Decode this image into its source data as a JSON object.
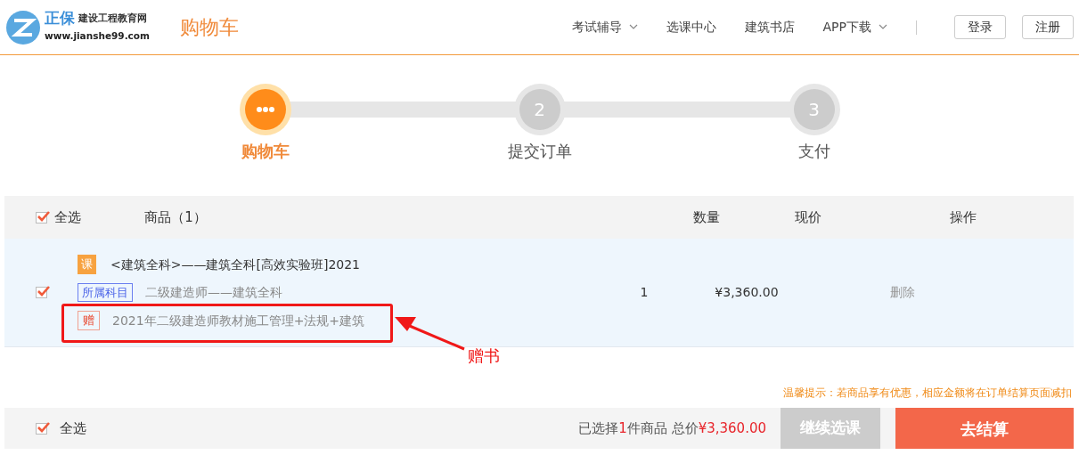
{
  "header": {
    "logo": {
      "brand": "正保",
      "tagline": "建设工程教育网",
      "url": "www.jianshe99.com"
    },
    "page_title": "购物车",
    "nav": [
      {
        "label": "考试辅导",
        "dropdown": true
      },
      {
        "label": "选课中心",
        "dropdown": false
      },
      {
        "label": "建筑书店",
        "dropdown": false
      },
      {
        "label": "APP下载",
        "dropdown": true
      }
    ],
    "buttons": [
      "登录",
      "注册"
    ]
  },
  "steps": [
    {
      "label": "购物车",
      "current": true
    },
    {
      "number": "2",
      "label": "提交订单",
      "current": false
    },
    {
      "number": "3",
      "label": "支付",
      "current": false
    }
  ],
  "table": {
    "select_all": {
      "label": "全选",
      "checked": true
    },
    "columns": [
      "商品（1）",
      "数量",
      "现价",
      "操作"
    ],
    "rows": [
      {
        "checked": true,
        "course_tag": "课",
        "title": "<建筑全科>——建筑全科[高效实验班]2021",
        "subject_tag": "所属科目",
        "subject": "二级建造师——建筑全科",
        "gift_tag": "赠",
        "gift": "2021年二级建造师教材施工管理+法规+建筑",
        "quantity": "1",
        "price": "¥3,360.00",
        "action": "删除"
      }
    ]
  },
  "annotation": {
    "label": "赠书"
  },
  "tip": "温馨提示：若商品享有优惠，相应金额将在订单结算页面减扣",
  "footer": {
    "select_all": {
      "label": "全选",
      "checked": true
    },
    "summary_prefix": "已选择",
    "count": "1",
    "summary_mid": "件商品 总价",
    "total": "¥3,360.00",
    "continue_button": "继续选课",
    "checkout_button": "去结算"
  }
}
